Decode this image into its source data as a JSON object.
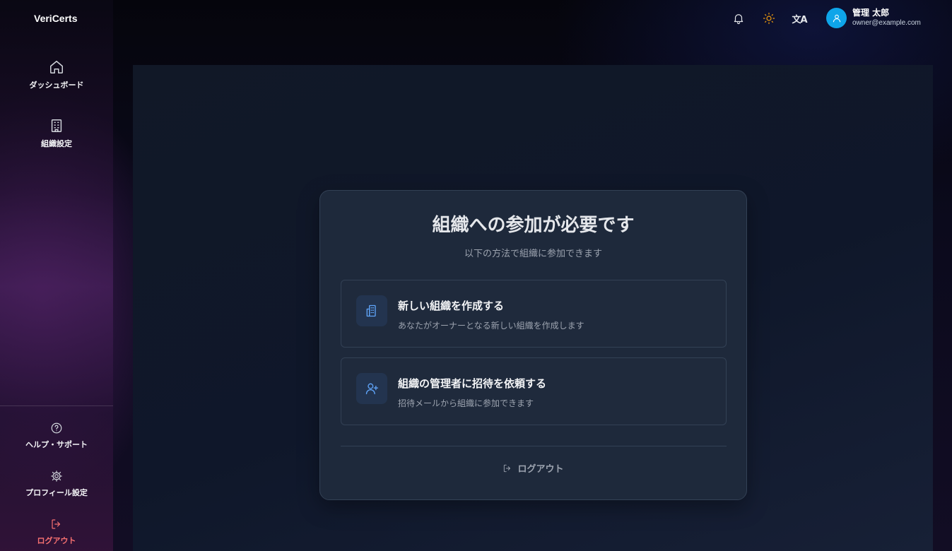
{
  "app": {
    "brand": "VeriCerts"
  },
  "sidebar": {
    "top_items": [
      {
        "label": "ダッシュボード",
        "icon": "home-icon"
      },
      {
        "label": "組織設定",
        "icon": "building-icon"
      }
    ],
    "bottom_items": [
      {
        "label": "ヘルプ・サポート",
        "icon": "help-circle-icon"
      },
      {
        "label": "プロフィール設定",
        "icon": "gear-icon"
      },
      {
        "label": "ログアウト",
        "icon": "logout-icon"
      }
    ]
  },
  "header": {
    "icons": [
      "bell-icon",
      "sun-icon",
      "translate-icon"
    ],
    "translate_glyph": "文A",
    "user": {
      "name": "管理 太郎",
      "email": "owner@example.com"
    }
  },
  "card": {
    "title": "組織への参加が必要です",
    "subtitle": "以下の方法で組織に参加できます",
    "options": [
      {
        "title": "新しい組織を作成する",
        "description": "あなたがオーナーとなる新しい組織を作成します",
        "icon": "building-icon"
      },
      {
        "title": "組織の管理者に招待を依頼する",
        "description": "招待メールから組織に参加できます",
        "icon": "user-plus-icon"
      }
    ],
    "logout_label": "ログアウト"
  },
  "colors": {
    "accent": "#60a5fa",
    "avatar": "#0ea5e9",
    "danger": "#f87171",
    "sun": "#f59e0b"
  }
}
